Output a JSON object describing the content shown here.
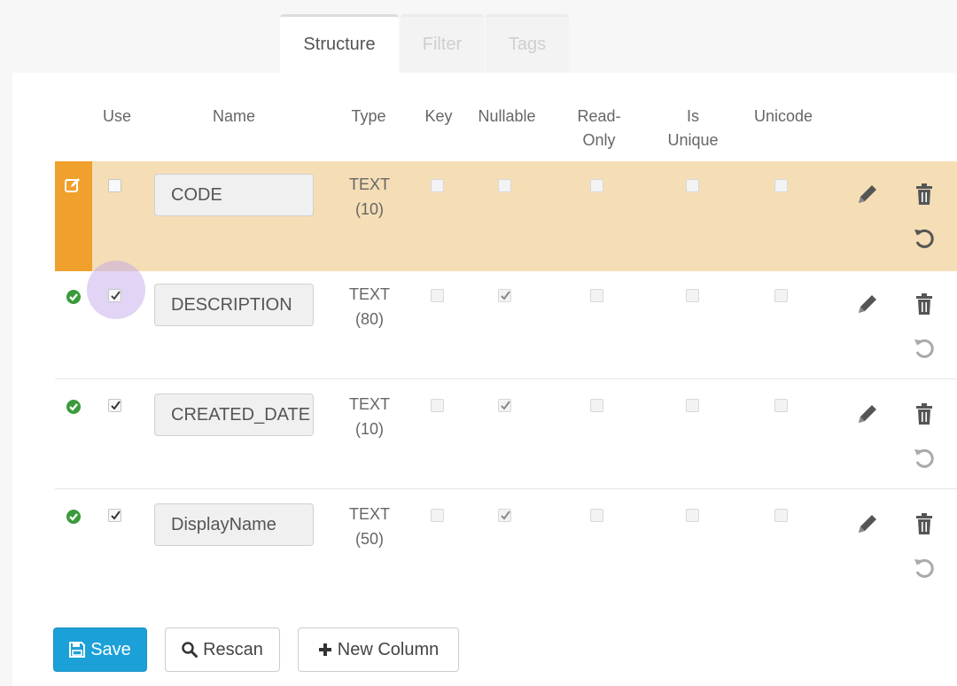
{
  "tabs": [
    {
      "label": "Structure",
      "active": true
    },
    {
      "label": "Filter",
      "active": false
    },
    {
      "label": "Tags",
      "active": false
    }
  ],
  "columns": {
    "use": "Use",
    "name": "Name",
    "type": "Type",
    "key": "Key",
    "nullable": "Nullable",
    "read_only_1": "Read-",
    "read_only_2": "Only",
    "is_unique_1": "Is",
    "is_unique_2": "Unique",
    "unicode": "Unicode"
  },
  "rows": [
    {
      "status": "editing",
      "use": false,
      "name": "CODE",
      "type_1": "TEXT",
      "type_2": "(10)",
      "key": false,
      "nullable": false,
      "read_only": false,
      "is_unique": false,
      "unicode": false
    },
    {
      "status": "ok",
      "use": true,
      "focused": true,
      "name": "DESCRIPTION",
      "type_1": "TEXT",
      "type_2": "(80)",
      "key": false,
      "nullable": true,
      "read_only": false,
      "is_unique": false,
      "unicode": false
    },
    {
      "status": "ok",
      "use": true,
      "name": "CREATED_DATE",
      "type_1": "TEXT",
      "type_2": "(10)",
      "key": false,
      "nullable": true,
      "read_only": false,
      "is_unique": false,
      "unicode": false
    },
    {
      "status": "ok",
      "use": true,
      "name": "DisplayName",
      "type_1": "TEXT",
      "type_2": "(50)",
      "key": false,
      "nullable": true,
      "read_only": false,
      "is_unique": false,
      "unicode": false
    }
  ],
  "buttons": {
    "save": "Save",
    "rescan": "Rescan",
    "new_column": "New Column"
  },
  "colors": {
    "accent": "#1ca0d8",
    "editing_row": "#f5deb6",
    "editing_strip": "#f0a02c",
    "ok_green": "#3a9a3a"
  }
}
